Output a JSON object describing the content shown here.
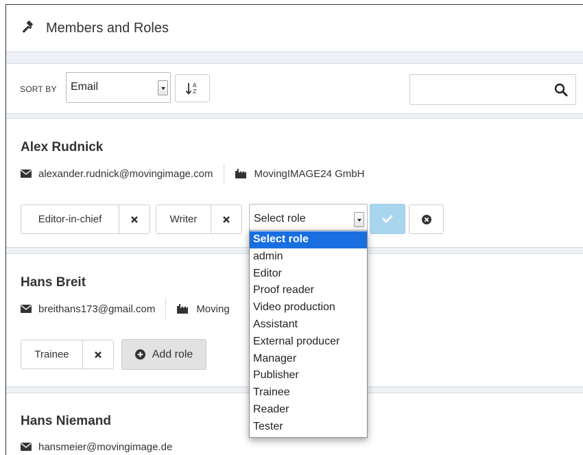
{
  "header": {
    "title": "Members and Roles",
    "icon": "gavel-icon"
  },
  "toolbar": {
    "sort_label": "SORT BY",
    "sort_value": "Email",
    "sort_direction_icon": "sort-alpha-asc-icon",
    "search_placeholder": "",
    "search_icon": "search-icon"
  },
  "members": [
    {
      "name": "Alex Rudnick",
      "email": "alexander.rudnick@movingimage.com",
      "company": "MovingIMAGE24 GmbH",
      "roles": [
        "Editor-in-chief",
        "Writer"
      ],
      "role_select_value": "Select role"
    },
    {
      "name": "Hans Breit",
      "email": "breithans173@gmail.com",
      "company": "Moving",
      "roles": [
        "Trainee"
      ],
      "add_role_label": "Add role"
    },
    {
      "name": "Hans Niemand",
      "email": "hansmeier@movingimage.de"
    }
  ],
  "role_dropdown": {
    "selected": "Select role",
    "options": [
      "Select role",
      "admin",
      "Editor",
      "Proof reader",
      "Video production",
      "Assistant",
      "External producer",
      "Manager",
      "Publisher",
      "Trainee",
      "Reader",
      "Tester"
    ]
  },
  "colors": {
    "accent_confirm": "#a9d6ee",
    "dropdown_highlight": "#1a6fe0",
    "separator_band": "#eef2f6",
    "add_role_bg": "#e2e2e2"
  }
}
